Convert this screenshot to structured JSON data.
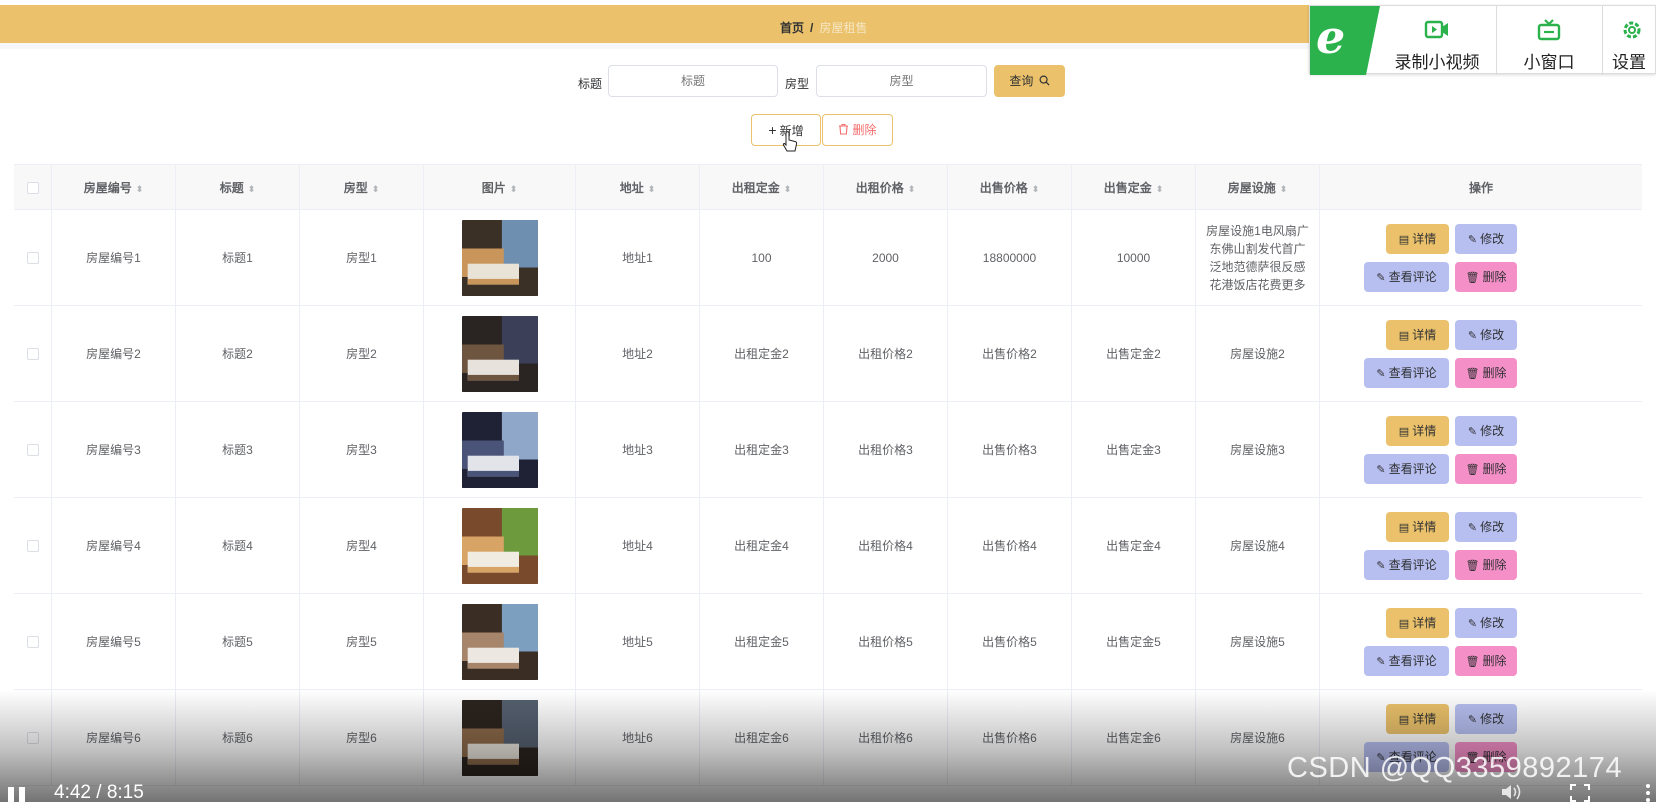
{
  "breadcrumb": {
    "home": "首页",
    "separator": "/",
    "current": "房屋租售"
  },
  "video_toolbar": {
    "record": "录制小视频",
    "mini_window": "小窗口",
    "settings": "设置"
  },
  "search": {
    "title_label": "标题",
    "title_placeholder": "标题",
    "type_label": "房型",
    "type_placeholder": "房型",
    "query_button": "查询"
  },
  "actions": {
    "add": "新增",
    "delete": "删除"
  },
  "table": {
    "columns": [
      "房屋编号",
      "标题",
      "房型",
      "图片",
      "地址",
      "出租定金",
      "出租价格",
      "出售价格",
      "出售定金",
      "房屋设施",
      "操作"
    ],
    "rows": [
      {
        "code": "房屋编号1",
        "title": "标题1",
        "type": "房型1",
        "address": "地址1",
        "rent_deposit": "100",
        "rent_price": "2000",
        "sale_price": "18800000",
        "sale_deposit": "10000",
        "facility": "房屋设施1电风扇广东佛山割发代首广泛地范德萨很反感花港饭店花费更多"
      },
      {
        "code": "房屋编号2",
        "title": "标题2",
        "type": "房型2",
        "address": "地址2",
        "rent_deposit": "出租定金2",
        "rent_price": "出租价格2",
        "sale_price": "出售价格2",
        "sale_deposit": "出售定金2",
        "facility": "房屋设施2"
      },
      {
        "code": "房屋编号3",
        "title": "标题3",
        "type": "房型3",
        "address": "地址3",
        "rent_deposit": "出租定金3",
        "rent_price": "出租价格3",
        "sale_price": "出售价格3",
        "sale_deposit": "出售定金3",
        "facility": "房屋设施3"
      },
      {
        "code": "房屋编号4",
        "title": "标题4",
        "type": "房型4",
        "address": "地址4",
        "rent_deposit": "出租定金4",
        "rent_price": "出租价格4",
        "sale_price": "出售价格4",
        "sale_deposit": "出售定金4",
        "facility": "房屋设施4"
      },
      {
        "code": "房屋编号5",
        "title": "标题5",
        "type": "房型5",
        "address": "地址5",
        "rent_deposit": "出租定金5",
        "rent_price": "出租价格5",
        "sale_price": "出售价格5",
        "sale_deposit": "出售定金5",
        "facility": "房屋设施5"
      },
      {
        "code": "房屋编号6",
        "title": "标题6",
        "type": "房型6",
        "address": "地址6",
        "rent_deposit": "出租定金6",
        "rent_price": "出租价格6",
        "sale_price": "出售价格6",
        "sale_deposit": "出售定金6",
        "facility": "房屋设施6"
      }
    ],
    "row_actions": {
      "detail": "详情",
      "edit": "修改",
      "review": "查看评论",
      "delete": "删除"
    }
  },
  "player": {
    "time": "4:42 / 8:15",
    "watermark": "CSDN @QQ3359892174"
  },
  "colors": {
    "accent": "#ebc26b",
    "edit": "#b7bff0",
    "danger": "#f58fc8",
    "brand_green": "#2bb24c"
  }
}
